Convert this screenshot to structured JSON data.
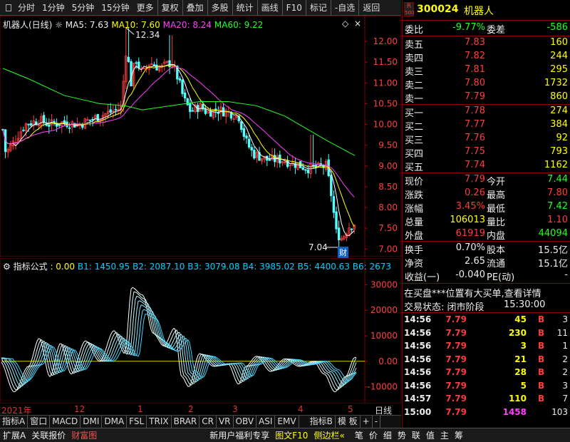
{
  "toolbar": {
    "items": [
      "分时",
      "1分钟",
      "5分钟",
      "15分钟",
      "更多",
      "复权",
      "叠加",
      "多股",
      "统计",
      "画线",
      "F10",
      "标记",
      "-自选",
      "返回"
    ]
  },
  "main_chart": {
    "title": "机器人(日线)",
    "ma5_label": "MA5: 7.63",
    "ma10_label": "MA10: 7.60",
    "ma20_label": "MA20: 8.24",
    "ma60_label": "MA60: 9.22",
    "high_marker": "12.34",
    "low_marker": "7.04",
    "finance_badge": "财",
    "y_ticks": [
      "12.00",
      "11.50",
      "11.00",
      "10.50",
      "10.00",
      "9.50",
      "9.00",
      "8.50",
      "8.00",
      "7.50",
      "7.00"
    ],
    "colors": {
      "up": "#ff3b3b",
      "down": "#54ffff",
      "ma5": "#ffffff",
      "ma10": "#ffff00",
      "ma20": "#ff40ff",
      "ma60": "#22ff22"
    }
  },
  "indicator": {
    "title": "指标公式",
    "v0": ": 0.00",
    "b1": "B1: 1450.95",
    "b2": "B2: 2087.10",
    "b3": "B3: 3079.08",
    "b4": "B4: 3985.02",
    "b5": "B5: 4400.63",
    "b6": "B6: 2673",
    "y_ticks": [
      "30000",
      "20000",
      "10000",
      "0.00",
      "-10000"
    ]
  },
  "x_axis": {
    "labels": [
      "2021年",
      "12",
      "1",
      "2",
      "3",
      "4",
      "5"
    ],
    "corner": "日线"
  },
  "tabs": [
    "指标A",
    "窗口",
    "MACD",
    "DMI",
    "DMA",
    "FSL",
    "TRIX",
    "BRAR",
    "CR",
    "VR",
    "OBV",
    "ASI",
    "EMV",
    "指标B",
    "模 板",
    "+",
    "-"
  ],
  "status": {
    "items": [
      "扩展A",
      "关联报价",
      "财富图",
      "新用户福利专享",
      "图文F10",
      "侧边栏«"
    ],
    "icons": [
      "笔",
      "价",
      "细",
      "势",
      "联",
      "值",
      "主",
      "筹"
    ]
  },
  "quote": {
    "code": "300024",
    "name": "机器人",
    "badge_r": "R",
    "badge_num": "500",
    "weibi_label": "委比",
    "weibi": "-9.77%",
    "weicha_label": "委差",
    "weicha": "-586",
    "asks": [
      {
        "label": "卖五",
        "price": "7.83",
        "vol": "160"
      },
      {
        "label": "卖四",
        "price": "7.82",
        "vol": "244"
      },
      {
        "label": "卖三",
        "price": "7.81",
        "vol": "295"
      },
      {
        "label": "卖二",
        "price": "7.80",
        "vol": "1732"
      },
      {
        "label": "卖一",
        "price": "7.79",
        "vol": "860"
      }
    ],
    "bids": [
      {
        "label": "买一",
        "price": "7.78",
        "vol": "274"
      },
      {
        "label": "买二",
        "price": "7.77",
        "vol": "384"
      },
      {
        "label": "买三",
        "price": "7.76",
        "vol": "92"
      },
      {
        "label": "买四",
        "price": "7.75",
        "vol": "793"
      },
      {
        "label": "买五",
        "price": "7.74",
        "vol": "1162"
      }
    ],
    "stats": [
      {
        "l1": "现价",
        "v1": "7.79",
        "c1": "red",
        "l2": "今开",
        "v2": "7.44",
        "c2": "green"
      },
      {
        "l1": "涨跌",
        "v1": "0.26",
        "c1": "red",
        "l2": "最高",
        "v2": "7.80",
        "c2": "red"
      },
      {
        "l1": "涨幅",
        "v1": "3.45%",
        "c1": "red",
        "l2": "最低",
        "v2": "7.42",
        "c2": "green"
      },
      {
        "l1": "总量",
        "v1": "106013",
        "c1": "yellow",
        "l2": "量比",
        "v2": "1.10",
        "c2": "red"
      },
      {
        "l1": "外盘",
        "v1": "61919",
        "c1": "red",
        "l2": "内盘",
        "v2": "44094",
        "c2": "green"
      }
    ],
    "stats2": [
      {
        "l1": "换手",
        "v1": "0.70%",
        "l2": "股本",
        "v2": "15.5亿"
      },
      {
        "l1": "净资",
        "v1": "2.65",
        "l2": "流通",
        "v2": "15.1亿"
      },
      {
        "l1": "收益(一)",
        "v1": "-0.040",
        "l2": "PE(动)",
        "v2": "-"
      }
    ],
    "notice": "在买盘***位置有大买单,查看详情",
    "trade_status_label": "交易状态: 闭市阶段",
    "trade_status_time": "15:30:00",
    "ticks": [
      {
        "time": "14:56",
        "price": "7.79",
        "vol": "45",
        "side": "B",
        "n": "3",
        "vc": "yellow"
      },
      {
        "time": "14:56",
        "price": "7.79",
        "vol": "230",
        "side": "B",
        "n": "11",
        "vc": "yellow"
      },
      {
        "time": "14:56",
        "price": "7.79",
        "vol": "3",
        "side": "B",
        "n": "1",
        "vc": "yellow"
      },
      {
        "time": "14:56",
        "price": "7.79",
        "vol": "21",
        "side": "B",
        "n": "2",
        "vc": "yellow"
      },
      {
        "time": "14:56",
        "price": "7.79",
        "vol": "28",
        "side": "B",
        "n": "2",
        "vc": "yellow"
      },
      {
        "time": "14:56",
        "price": "7.79",
        "vol": "5",
        "side": "B",
        "n": "3",
        "vc": "yellow"
      },
      {
        "time": "14:57",
        "price": "7.79",
        "vol": "110",
        "side": "B",
        "n": "7",
        "vc": "yellow"
      },
      {
        "time": "15:00",
        "price": "7.79",
        "vol": "1458",
        "side": "",
        "n": "103",
        "vc": "magenta"
      }
    ]
  }
}
